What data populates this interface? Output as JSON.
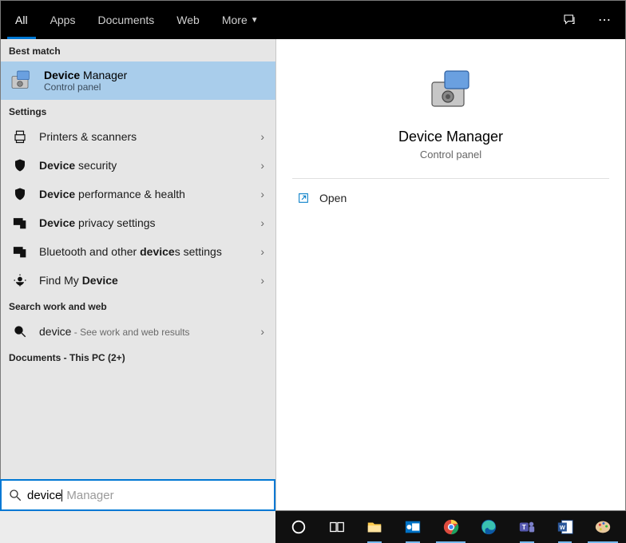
{
  "tabs": {
    "all": "All",
    "apps": "Apps",
    "documents": "Documents",
    "web": "Web",
    "more": "More"
  },
  "sections": {
    "best": "Best match",
    "settings": "Settings",
    "web": "Search work and web",
    "docs": "Documents - This PC (2+)"
  },
  "best_match": {
    "title_bold": "Device",
    "title_rest": " Manager",
    "sub": "Control panel"
  },
  "settings_items": [
    {
      "icon": "printer",
      "pre": "",
      "bold": "",
      "post": "Printers & scanners"
    },
    {
      "icon": "shield",
      "pre": "",
      "bold": "Device",
      "post": " security"
    },
    {
      "icon": "shield",
      "pre": "",
      "bold": "Device",
      "post": " performance & health"
    },
    {
      "icon": "privacy",
      "pre": "",
      "bold": "Device",
      "post": " privacy settings"
    },
    {
      "icon": "bt",
      "pre": "Bluetooth and other ",
      "bold": "device",
      "post": "s settings"
    },
    {
      "icon": "findmy",
      "pre": "Find My ",
      "bold": "Device",
      "post": ""
    }
  ],
  "web_item": {
    "query": "device",
    "hint": " - See work and web results"
  },
  "preview": {
    "title": "Device Manager",
    "sub": "Control panel",
    "open": "Open"
  },
  "search": {
    "typed": "device",
    "ghost": " Manager"
  },
  "taskbar": [
    "cortana",
    "taskview",
    "explorer",
    "outlook",
    "chrome",
    "edge",
    "teams",
    "word",
    "paint"
  ]
}
